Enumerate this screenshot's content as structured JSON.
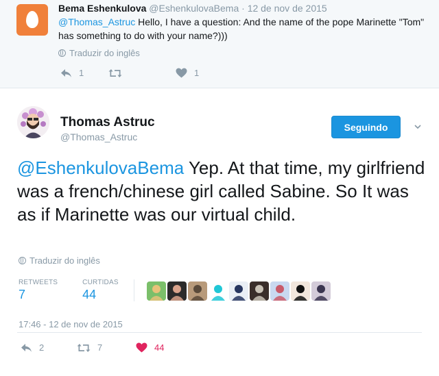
{
  "reply": {
    "name": "Bema Eshenkulova",
    "handle": "@EshenkulovaBema",
    "separator": "·",
    "date": "12 de nov de 2015",
    "mention": "@Thomas_Astruc",
    "text": " Hello, I have a question: And the name of the pope Marinette \"Tom\" has something to do with your name?)))",
    "translate": "Traduzir do inglês",
    "reply_count": "1",
    "retweet_count": "",
    "like_count": "1"
  },
  "tweet": {
    "name": "Thomas Astruc",
    "handle": "@Thomas_Astruc",
    "follow_label": "Seguindo",
    "mention": "@EshenkulovaBema",
    "text": " Yep. At that time, my girlfriend was a french/chinese girl called Sabine. So It was as if Marinette was our virtual child.",
    "translate": "Traduzir do inglês",
    "retweets_label": "RETWEETS",
    "retweets_value": "7",
    "likes_label": "CURTIDAS",
    "likes_value": "44",
    "timestamp": "17:46 - 12 de nov de 2015",
    "reply_count": "2",
    "retweet_count": "7",
    "like_count": "44"
  },
  "likers": [
    {
      "bg": "#7bbf6a",
      "fg": "#e8c27a"
    },
    {
      "bg": "#2b2b2b",
      "fg": "#d9a38c"
    },
    {
      "bg": "#b89a7a",
      "fg": "#5a4a3a"
    },
    {
      "bg": "#ffffff",
      "fg": "#1fc7d6"
    },
    {
      "bg": "#e9eef5",
      "fg": "#26355f"
    },
    {
      "bg": "#3a2e2a",
      "fg": "#c9c2b6"
    },
    {
      "bg": "#c9d8f0",
      "fg": "#c95a6a"
    },
    {
      "bg": "#f1e6dc",
      "fg": "#111111"
    },
    {
      "bg": "#d3cbd9",
      "fg": "#3a3550"
    }
  ],
  "colors": {
    "accent": "#1b95e0",
    "like_active": "#e0245e",
    "muted": "#8899a6"
  }
}
